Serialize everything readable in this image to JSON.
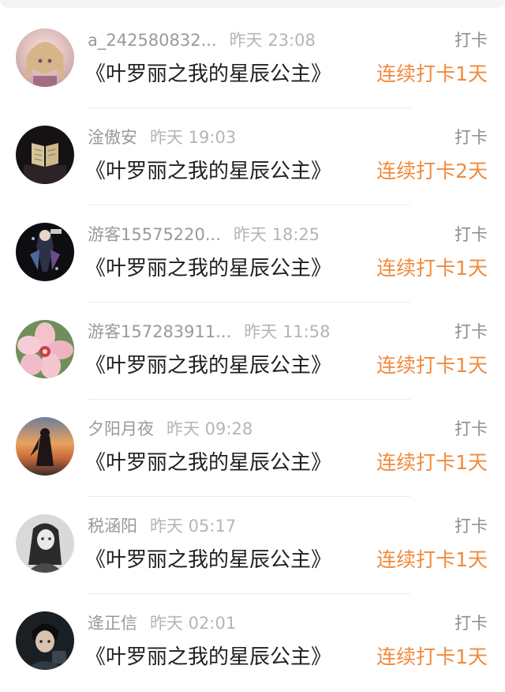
{
  "checkins": [
    {
      "avatar_icon": "anime-girl-avatar-icon",
      "username": "a_242580832...",
      "time": "昨天 23:08",
      "action": "打卡",
      "book": "《叶罗丽之我的星辰公主》",
      "streak": "连续打卡1天"
    },
    {
      "avatar_icon": "book-dark-avatar-icon",
      "username": "淦傲安",
      "time": "昨天 19:03",
      "action": "打卡",
      "book": "《叶罗丽之我的星辰公主》",
      "streak": "连续打卡2天"
    },
    {
      "avatar_icon": "anime-poster-avatar-icon",
      "username": "游客15575220...",
      "time": "昨天 18:25",
      "action": "打卡",
      "book": "《叶罗丽之我的星辰公主》",
      "streak": "连续打卡1天"
    },
    {
      "avatar_icon": "pink-flower-avatar-icon",
      "username": "游客157283911...",
      "time": "昨天 11:58",
      "action": "打卡",
      "book": "《叶罗丽之我的星辰公主》",
      "streak": "连续打卡1天"
    },
    {
      "avatar_icon": "sunset-silhouette-avatar-icon",
      "username": "夕阳月夜",
      "time": "昨天 09:28",
      "action": "打卡",
      "book": "《叶罗丽之我的星辰公主》",
      "streak": "连续打卡1天"
    },
    {
      "avatar_icon": "grayscale-girl-avatar-icon",
      "username": "税涵阳",
      "time": "昨天 05:17",
      "action": "打卡",
      "book": "《叶罗丽之我的星辰公主》",
      "streak": "连续打卡1天"
    },
    {
      "avatar_icon": "dark-portrait-avatar-icon",
      "username": "逄正信",
      "time": "昨天 02:01",
      "action": "打卡",
      "book": "《叶罗丽之我的星辰公主》",
      "streak": "连续打卡1天"
    }
  ],
  "colors": {
    "streak": "#f08a3c",
    "meta": "#9a9a9a",
    "title": "#1f1f1f"
  }
}
